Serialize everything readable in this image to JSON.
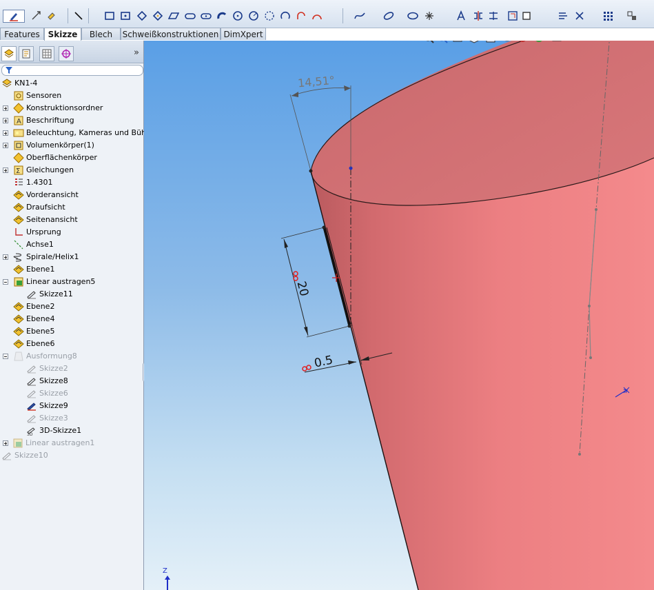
{
  "toolbar": {
    "icons": [
      "sketch-icon",
      "smart-dimension-icon",
      "line-icon",
      "rectangle-icon",
      "center-rectangle-icon",
      "polygon-icon",
      "parallelogram-icon",
      "slot-icon",
      "circle-icon",
      "arc-icon",
      "spline-icon",
      "ellipse-icon",
      "point-icon",
      "mirror-icon",
      "trim-icon",
      "offset-icon",
      "pattern-icon",
      "relations-icon"
    ]
  },
  "tabs": [
    {
      "label": "Features",
      "active": false
    },
    {
      "label": "Skizze",
      "active": true
    },
    {
      "label": "Blech",
      "active": false
    },
    {
      "label": "Schweißkonstruktionen",
      "active": false
    },
    {
      "label": "DimXpert",
      "active": false
    }
  ],
  "panel": {
    "expand_symbol": "»"
  },
  "tree": [
    {
      "label": "KN1-4",
      "indent": 0,
      "expander": null,
      "icon": "part-icon",
      "dim": false
    },
    {
      "label": "Sensoren",
      "indent": 1,
      "expander": null,
      "icon": "sensor-icon",
      "dim": false
    },
    {
      "label": "Konstruktionsordner",
      "indent": 1,
      "expander": "plus",
      "icon": "design-binder-icon",
      "dim": false
    },
    {
      "label": "Beschriftung",
      "indent": 1,
      "expander": "plus",
      "icon": "annotation-icon",
      "dim": false
    },
    {
      "label": "Beleuchtung, Kameras und Bühne",
      "indent": 1,
      "expander": "plus",
      "icon": "lighting-icon",
      "dim": false
    },
    {
      "label": "Volumenkörper(1)",
      "indent": 1,
      "expander": "plus",
      "icon": "solid-bodies-icon",
      "dim": false
    },
    {
      "label": "Oberflächenkörper",
      "indent": 1,
      "expander": null,
      "icon": "surface-bodies-icon",
      "dim": false
    },
    {
      "label": "Gleichungen",
      "indent": 1,
      "expander": "plus",
      "icon": "equations-icon",
      "dim": false
    },
    {
      "label": "1.4301",
      "indent": 1,
      "expander": null,
      "icon": "material-icon",
      "dim": false
    },
    {
      "label": "Vorderansicht",
      "indent": 1,
      "expander": null,
      "icon": "plane-icon",
      "dim": false
    },
    {
      "label": "Draufsicht",
      "indent": 1,
      "expander": null,
      "icon": "plane-icon",
      "dim": false
    },
    {
      "label": "Seitenansicht",
      "indent": 1,
      "expander": null,
      "icon": "plane-icon",
      "dim": false
    },
    {
      "label": "Ursprung",
      "indent": 1,
      "expander": null,
      "icon": "origin-icon",
      "dim": false
    },
    {
      "label": "Achse1",
      "indent": 1,
      "expander": null,
      "icon": "axis-icon",
      "dim": false
    },
    {
      "label": "Spirale/Helix1",
      "indent": 1,
      "expander": "plus",
      "icon": "helix-icon",
      "dim": false
    },
    {
      "label": "Ebene1",
      "indent": 1,
      "expander": null,
      "icon": "plane-icon",
      "dim": false
    },
    {
      "label": "Linear austragen5",
      "indent": 1,
      "expander": "minus",
      "icon": "extrude-icon",
      "dim": false
    },
    {
      "label": "Skizze11",
      "indent": 2,
      "expander": null,
      "icon": "sketch-icon",
      "dim": false
    },
    {
      "label": "Ebene2",
      "indent": 1,
      "expander": null,
      "icon": "plane-icon",
      "dim": false
    },
    {
      "label": "Ebene4",
      "indent": 1,
      "expander": null,
      "icon": "plane-icon",
      "dim": false
    },
    {
      "label": "Ebene5",
      "indent": 1,
      "expander": null,
      "icon": "plane-icon",
      "dim": false
    },
    {
      "label": "Ebene6",
      "indent": 1,
      "expander": null,
      "icon": "plane-icon",
      "dim": false
    },
    {
      "label": "Ausformung8",
      "indent": 1,
      "expander": "minus",
      "icon": "loft-icon",
      "dim": true
    },
    {
      "label": "Skizze2",
      "indent": 2,
      "expander": null,
      "icon": "sketch-icon",
      "dim": true
    },
    {
      "label": "Skizze8",
      "indent": 2,
      "expander": null,
      "icon": "sketch-icon",
      "dim": false
    },
    {
      "label": "Skizze6",
      "indent": 2,
      "expander": null,
      "icon": "sketch-icon",
      "dim": true
    },
    {
      "label": "Skizze9",
      "indent": 2,
      "expander": null,
      "icon": "sketch-active-icon",
      "dim": false
    },
    {
      "label": "Skizze3",
      "indent": 2,
      "expander": null,
      "icon": "sketch-icon",
      "dim": true
    },
    {
      "label": "3D-Skizze1",
      "indent": 2,
      "expander": null,
      "icon": "sketch3d-icon",
      "dim": false
    },
    {
      "label": "Linear austragen1",
      "indent": 0,
      "expander": "plus",
      "icon": "extrude-icon",
      "dim": true
    },
    {
      "label": "Skizze10",
      "indent": 0,
      "expander": null,
      "icon": "sketch-icon",
      "dim": true
    }
  ],
  "viewport": {
    "dimensions": {
      "angle": "14,51°",
      "length": "20",
      "thickness": "0.5"
    },
    "triad_axis_label": "Z",
    "colors": {
      "model": "#e8777a",
      "sky_top": "#5a9fe6",
      "sky_bottom": "#e4f0f8"
    }
  }
}
